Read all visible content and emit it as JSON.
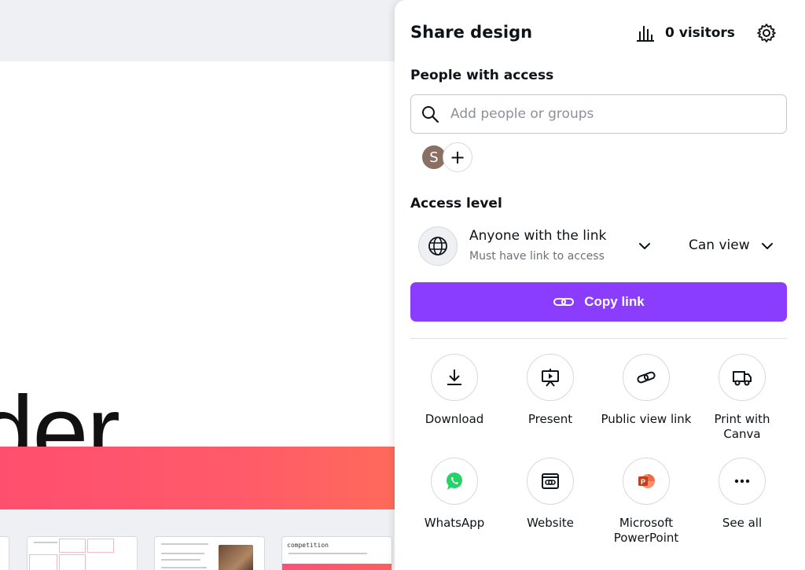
{
  "canvas": {
    "headline_fragment": "der",
    "thumb_label": "competition"
  },
  "share_panel": {
    "title": "Share design",
    "visitors": "0 visitors",
    "people_section_label": "People with access",
    "search_placeholder": "Add people or groups",
    "avatar_initial": "S",
    "add_person_symbol": "+",
    "access_section_label": "Access level",
    "access_option": "Anyone with the link",
    "access_option_hint": "Must have link to access",
    "permission": "Can view",
    "copy_link_label": "Copy link",
    "share_options": [
      {
        "label": "Download",
        "icon": "download-icon"
      },
      {
        "label": "Present",
        "icon": "present-icon"
      },
      {
        "label": "Public view link",
        "icon": "link-icon"
      },
      {
        "label": "Print with Canva",
        "icon": "truck-icon"
      },
      {
        "label": "WhatsApp",
        "icon": "whatsapp-icon"
      },
      {
        "label": "Website",
        "icon": "website-icon"
      },
      {
        "label": "Microsoft PowerPoint",
        "icon": "powerpoint-icon"
      },
      {
        "label": "See all",
        "icon": "more-icon"
      }
    ]
  },
  "colors": {
    "accent": "#8b3dff",
    "canvas_band": "#ff5a6a",
    "whatsapp": "#25d366",
    "powerpoint": "#d24726"
  }
}
